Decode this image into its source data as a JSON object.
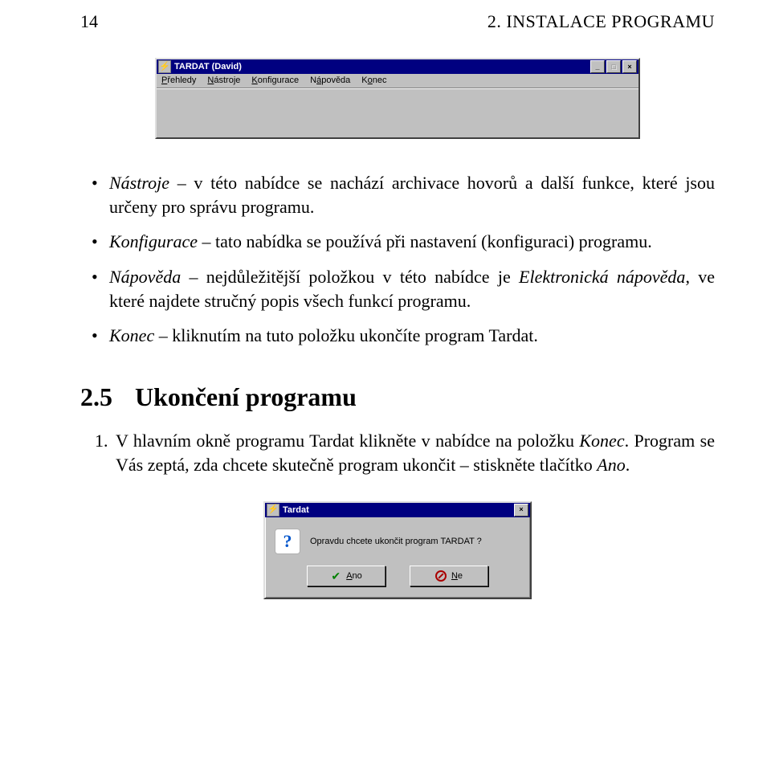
{
  "header": {
    "page_number": "14",
    "chapter": "2. INSTALACE PROGRAMU"
  },
  "main_window": {
    "title": "TARDAT (David)",
    "menu": {
      "prehledy": {
        "u": "P",
        "rest": "řehledy"
      },
      "nastroje": {
        "u": "N",
        "rest": "ástroje"
      },
      "konfigurace": {
        "u": "K",
        "rest": "onfigurace"
      },
      "napoveda": {
        "pre": "N",
        "u": "á",
        "rest": "pověda"
      },
      "konec": {
        "pre": "K",
        "u": "o",
        "rest": "nec"
      }
    },
    "icon_glyph": "⚡"
  },
  "bullets": {
    "b1": {
      "name": "Nástroje",
      "text": " – v této nabídce se nachází archivace hovorů a další funkce, které jsou určeny pro správu programu."
    },
    "b2": {
      "name": "Konfigurace",
      "text": " – tato nabídka se používá při nastavení (konfiguraci) programu."
    },
    "b3": {
      "name": "Nápověda",
      "text_a": " – nejdůležitější položkou v této nabídce je ",
      "em": "Elektronická nápověda",
      "text_b": ", ve které najdete stručný popis všech funkcí programu."
    },
    "b4": {
      "name": "Konec",
      "text": " – kliknutím na tuto položku ukončíte program Tardat."
    }
  },
  "section": {
    "num": "2.5",
    "title": "Ukončení programu"
  },
  "steps": {
    "s1": {
      "a": "V hlavním okně programu Tardat klikněte v nabídce na položku ",
      "em": "Konec",
      "b": ". Program se Vás zeptá, zda chcete skutečně program ukončit – stiskněte tlačítko ",
      "em2": "Ano",
      "c": "."
    }
  },
  "dialog": {
    "title": "Tardat",
    "icon_glyph": "⚡",
    "message": "Opravdu chcete ukončit program TARDAT ?",
    "yes": {
      "u": "A",
      "rest": "no"
    },
    "no": {
      "u": "N",
      "rest": "e"
    },
    "check_glyph": "✔"
  }
}
